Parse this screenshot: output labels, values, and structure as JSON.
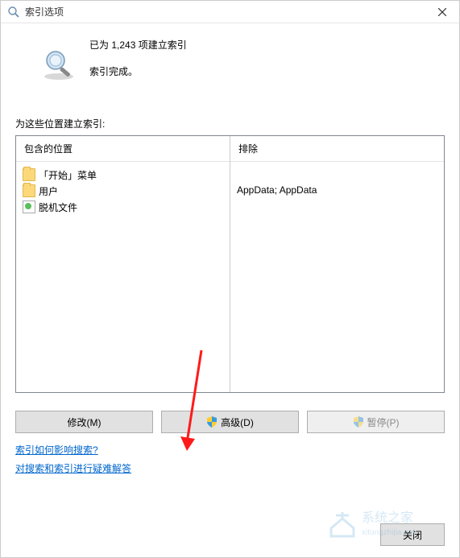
{
  "titlebar": {
    "title": "索引选项"
  },
  "status": {
    "line1": "已为 1,243 项建立索引",
    "line2": "索引完成。"
  },
  "locations": {
    "section_label": "为这些位置建立索引:",
    "included_header": "包含的位置",
    "excluded_header": "排除",
    "included_items": [
      {
        "icon": "folder",
        "label": "「开始」菜单"
      },
      {
        "icon": "folder",
        "label": "用户"
      },
      {
        "icon": "offline",
        "label": "脱机文件"
      }
    ],
    "excluded_text": "AppData; AppData"
  },
  "buttons": {
    "modify": "修改(M)",
    "advanced": "高级(D)",
    "pause": "暂停(P)",
    "close": "关闭"
  },
  "links": {
    "help1": "索引如何影响搜索?",
    "help2": "对搜索和索引进行疑难解答"
  },
  "watermark": {
    "text": "系统之家",
    "url": "xitongzhijia.net"
  }
}
